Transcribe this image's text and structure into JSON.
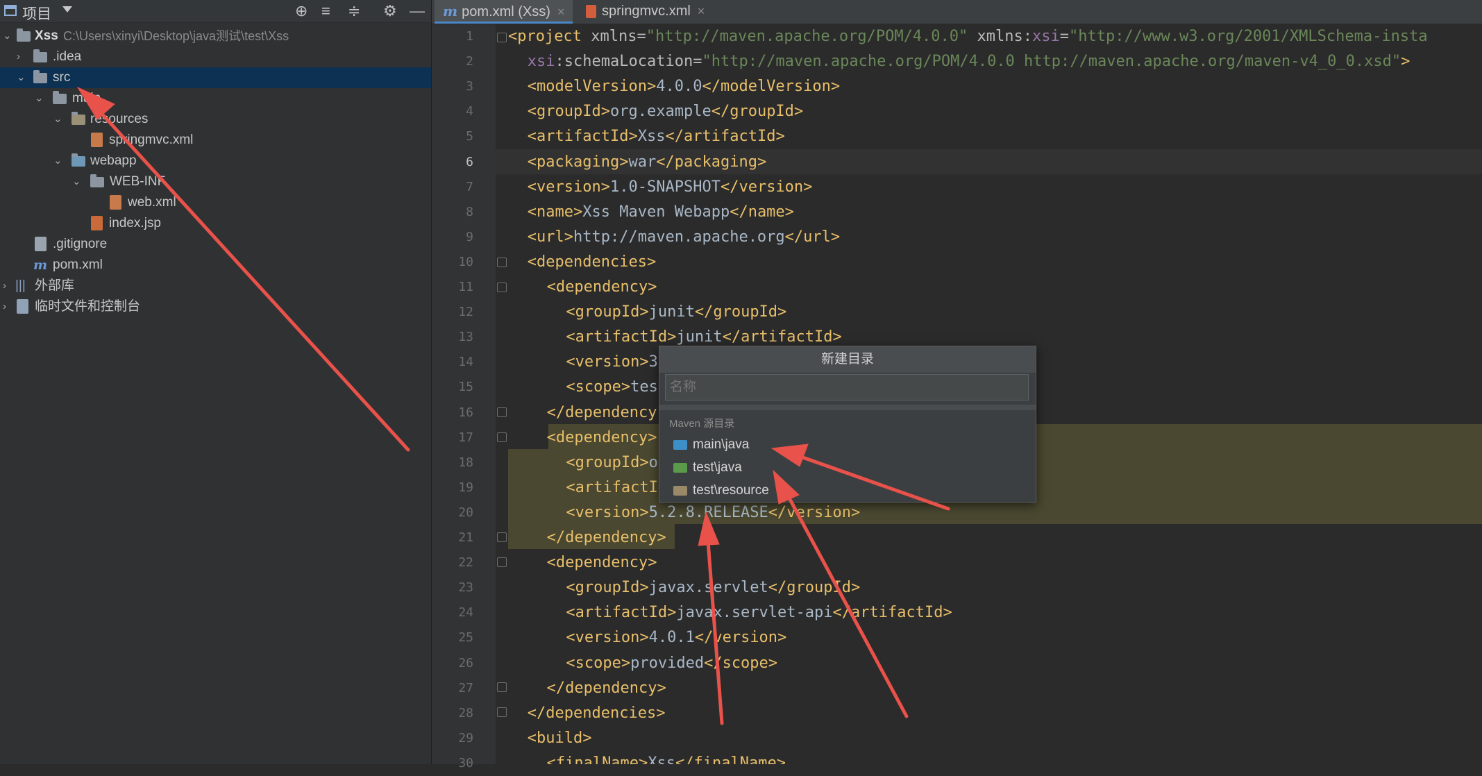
{
  "project_panel": {
    "title": "项目",
    "root": {
      "name": "Xss",
      "path": "C:\\Users\\xinyi\\Desktop\\java测试\\test\\Xss"
    },
    "items": [
      {
        "label": ".idea"
      },
      {
        "label": "src"
      },
      {
        "label": "main"
      },
      {
        "label": "resources"
      },
      {
        "label": "springmvc.xml"
      },
      {
        "label": "webapp"
      },
      {
        "label": "WEB-INF"
      },
      {
        "label": "web.xml"
      },
      {
        "label": "index.jsp"
      },
      {
        "label": ".gitignore"
      },
      {
        "label": "pom.xml"
      },
      {
        "label": "外部库"
      },
      {
        "label": "临时文件和控制台"
      }
    ]
  },
  "tabs": [
    {
      "label": "pom.xml (Xss)",
      "icon": "maven-icon",
      "active": true
    },
    {
      "label": "springmvc.xml",
      "icon": "xml-file-icon",
      "active": false
    }
  ],
  "editor": {
    "current_line": 6,
    "line_numbers": [
      "1",
      "2",
      "3",
      "4",
      "5",
      "6",
      "7",
      "8",
      "9",
      "10",
      "11",
      "12",
      "13",
      "14",
      "15",
      "16",
      "17",
      "18",
      "19",
      "20",
      "21",
      "22",
      "23",
      "24",
      "25",
      "26",
      "27",
      "28",
      "29",
      "30"
    ]
  },
  "code_text": {
    "l1": [
      "<project ",
      "xmlns",
      "=",
      "\"http://maven.apache.org/POM/4.0.0\"",
      " xmlns:",
      "xsi",
      "=",
      "\"http://www.w3.org/2001/XMLSchema-insta"
    ],
    "l2": [
      "xsi",
      ":schemaLocation=",
      "\"http://maven.apache.org/POM/4.0.0 http://maven.apache.org/maven-v4_0_0.xsd\"",
      ">"
    ],
    "l3": [
      "<modelVersion>",
      "4.0.0",
      "</modelVersion>"
    ],
    "l4": [
      "<groupId>",
      "org.example",
      "</groupId>"
    ],
    "l5": [
      "<artifactId>",
      "Xss",
      "</artifactId>"
    ],
    "l6": [
      "<packaging>",
      "war",
      "</packaging>"
    ],
    "l7": [
      "<version>",
      "1.0-SNAPSHOT",
      "</version>"
    ],
    "l8": [
      "<name>",
      "Xss Maven Webapp",
      "</name>"
    ],
    "l9": [
      "<url>",
      "http://maven.apache.org",
      "</url>"
    ],
    "l10": [
      "<dependencies>"
    ],
    "l11": [
      "<dependency>"
    ],
    "l12": [
      "<groupId>",
      "junit",
      "</groupId>"
    ],
    "l13": [
      "<artifactId>",
      "junit",
      "</artifactId>"
    ],
    "l14": [
      "<version>",
      "3"
    ],
    "l15": [
      "<scope>",
      "tes"
    ],
    "l16": [
      "</dependency"
    ],
    "l17": [
      "<dependency>"
    ],
    "l18": [
      "<groupId>",
      "o"
    ],
    "l19": [
      "<artifactI"
    ],
    "l20": [
      "<version>",
      "5.2.8.RELEASE",
      "</version>"
    ],
    "l21": [
      "</dependency>"
    ],
    "l22": [
      "<dependency>"
    ],
    "l23": [
      "<groupId>",
      "javax.servlet",
      "</groupId>"
    ],
    "l24": [
      "<artifactId>",
      "javax.servlet-api",
      "</artifactId>"
    ],
    "l25": [
      "<version>",
      "4.0.1",
      "</version>"
    ],
    "l26": [
      "<scope>",
      "provided",
      "</scope>"
    ],
    "l27": [
      "</dependency>"
    ],
    "l28": [
      "</dependencies>"
    ],
    "l29": [
      "<build>"
    ],
    "l30": [
      "<finalName>",
      "Xss",
      "</finalName>"
    ]
  },
  "popup": {
    "title": "新建目录",
    "placeholder": "名称",
    "section": "Maven 源目录",
    "items": [
      {
        "label": "main\\java",
        "color": "#3d8fc7"
      },
      {
        "label": "test\\java",
        "color": "#5a9a4a"
      },
      {
        "label": "test\\resource",
        "color": "#9a8a6a"
      }
    ]
  },
  "colors": {
    "selection": "#0d3152",
    "arrow": "#e8524a",
    "highlight": "#4a4830"
  }
}
